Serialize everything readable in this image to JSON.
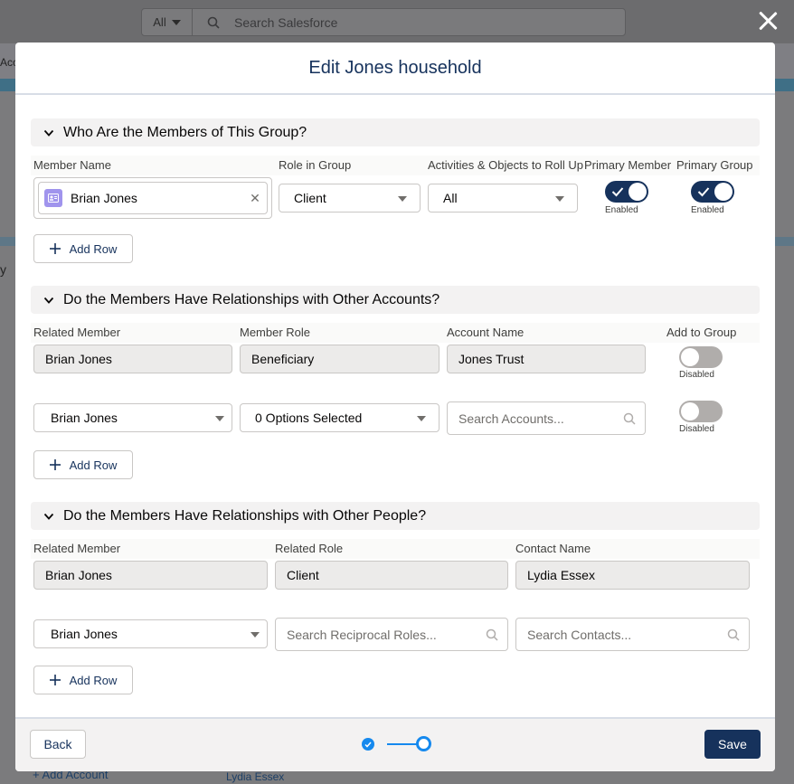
{
  "background": {
    "scope_label": "All",
    "search_placeholder": "Search Salesforce",
    "edge_text": "Acc",
    "edge_letter": "y",
    "bottom_link": "+ Add Account",
    "bottom_link2": "Lydia Essex"
  },
  "modal": {
    "title": "Edit Jones household",
    "close_icon": "close-icon"
  },
  "section1": {
    "title": "Who Are the Members of This Group?",
    "columns": [
      "Member Name",
      "Role in Group",
      "Activities & Objects to Roll Up",
      "Primary Member",
      "Primary Group"
    ],
    "row": {
      "member": "Brian Jones",
      "role": "Client",
      "rollup": "All",
      "primary_member_status": "Enabled",
      "primary_member_on": true,
      "primary_group_status": "Enabled",
      "primary_group_on": true
    },
    "add_row": "Add Row"
  },
  "section2": {
    "title": "Do the Members Have Relationships with Other Accounts?",
    "columns": [
      "Related Member",
      "Member Role",
      "Account Name",
      "Add to Group"
    ],
    "existing_row": {
      "member": "Brian Jones",
      "role": "Beneficiary",
      "account": "Jones Trust",
      "status": "Disabled",
      "on": false
    },
    "new_row": {
      "member": "Brian Jones",
      "role": "0 Options Selected",
      "account_placeholder": "Search Accounts...",
      "status": "Disabled",
      "on": false
    },
    "add_row": "Add Row"
  },
  "section3": {
    "title": "Do the Members Have Relationships with Other People?",
    "columns": [
      "Related Member",
      "Related Role",
      "Contact Name"
    ],
    "existing_row": {
      "member": "Brian Jones",
      "role": "Client",
      "contact": "Lydia Essex"
    },
    "new_row": {
      "member": "Brian Jones",
      "role_placeholder": "Search Reciprocal Roles...",
      "contact_placeholder": "Search Contacts..."
    },
    "add_row": "Add Row"
  },
  "footer": {
    "back": "Back",
    "save": "Save",
    "progress": {
      "steps": 2,
      "current": 2
    }
  },
  "colors": {
    "brand": "#16325c",
    "progress": "#1589ee",
    "section_bg": "#f3f2f2"
  }
}
